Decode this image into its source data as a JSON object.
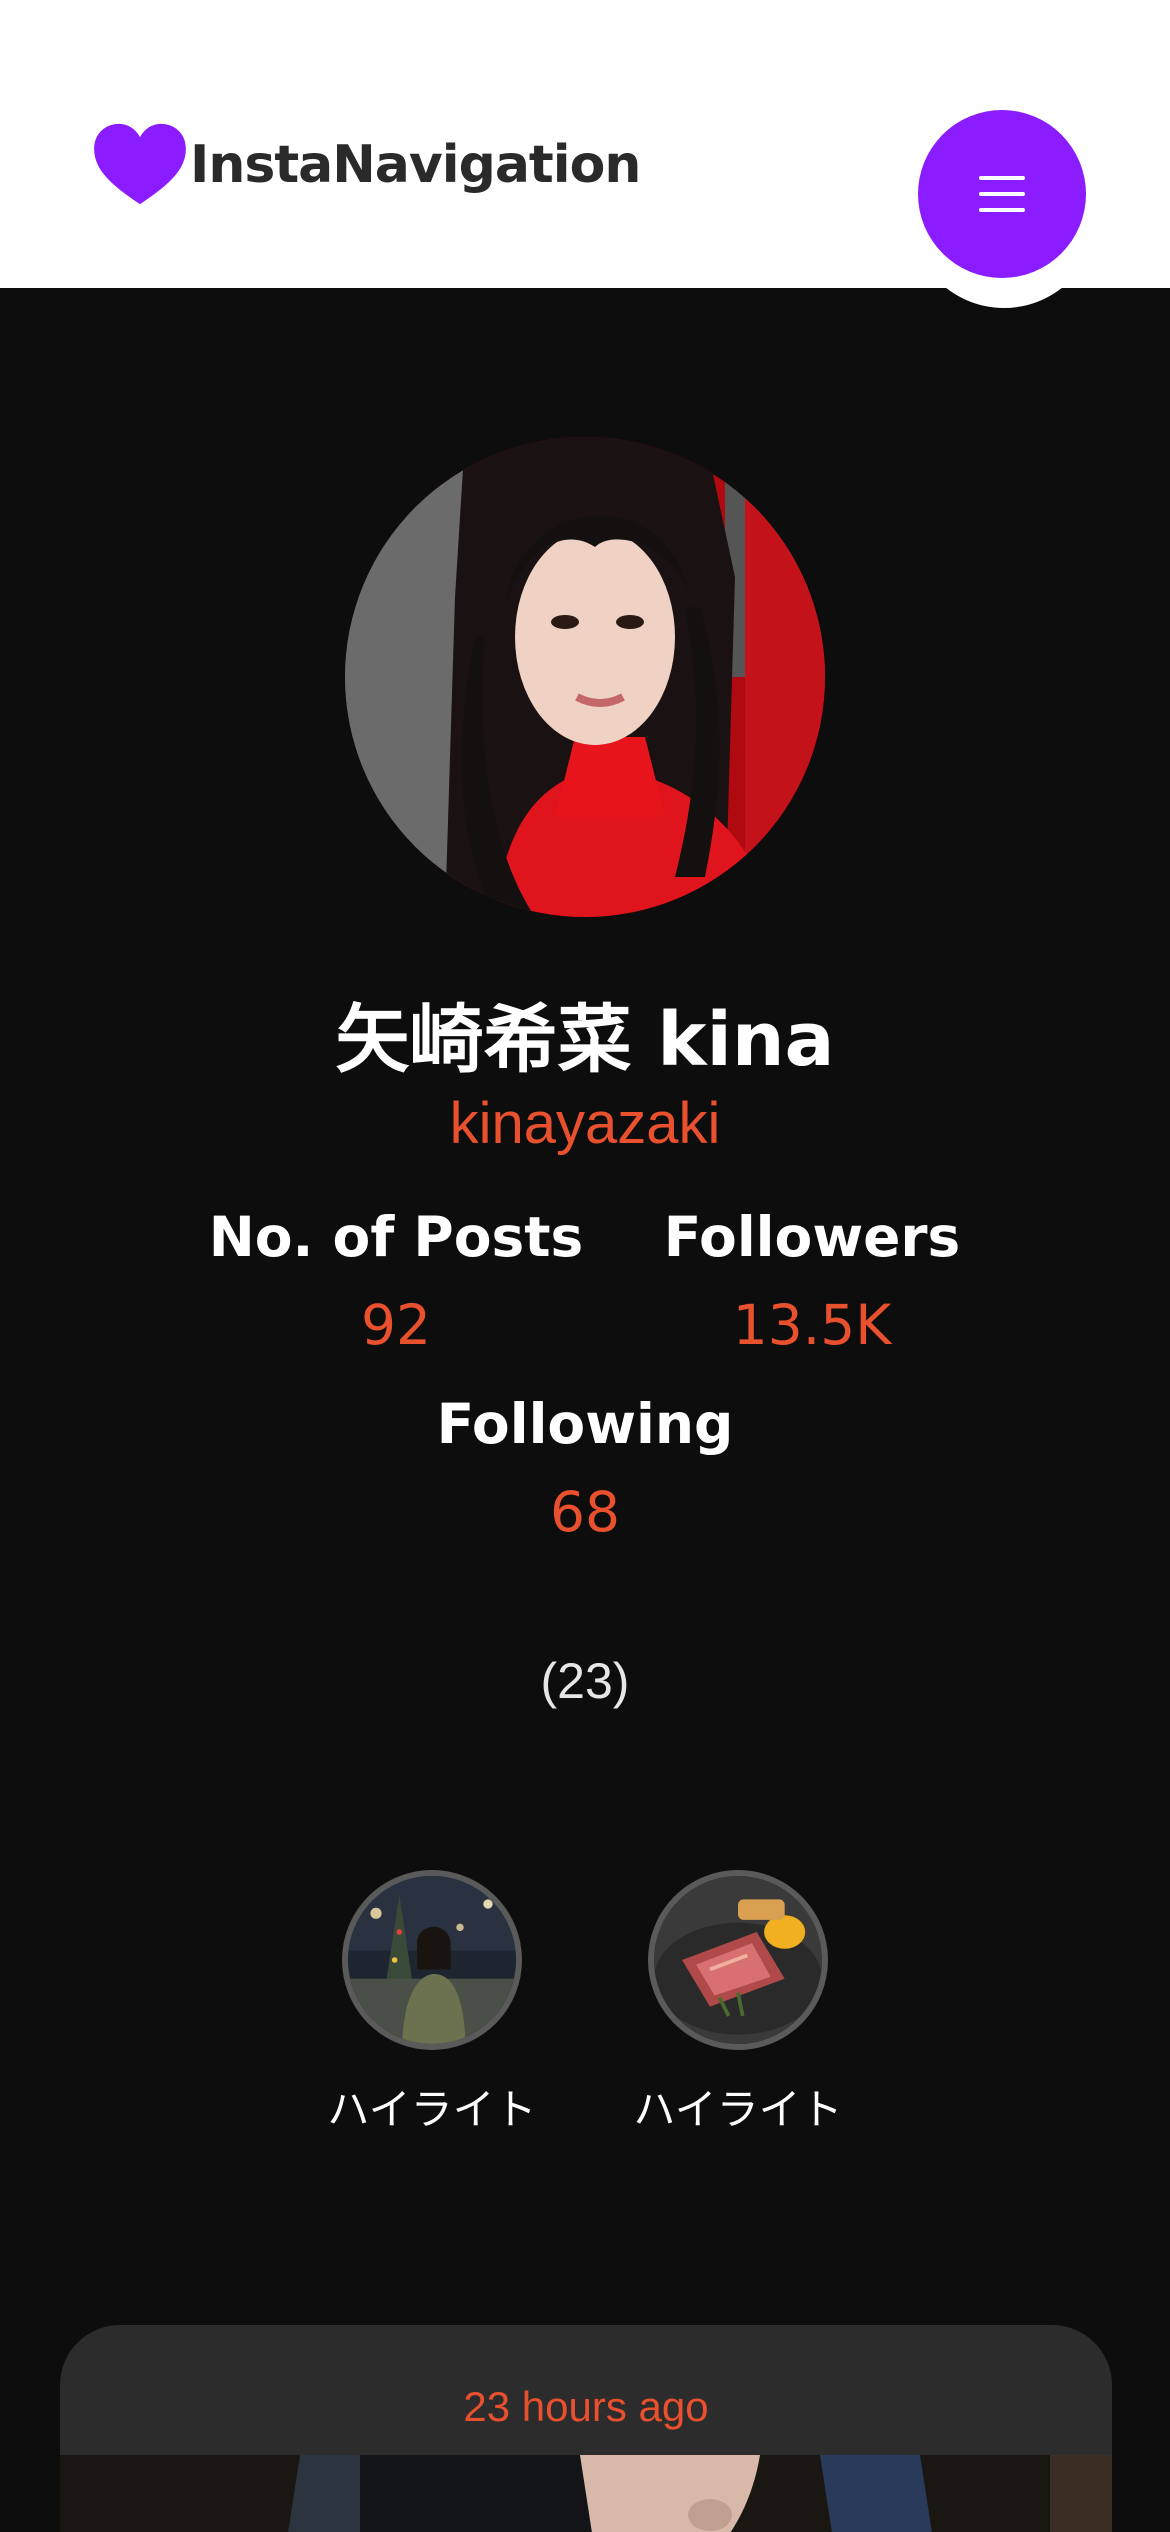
{
  "header": {
    "logo_text": "InstaNavigation",
    "logo_icon": "heart-icon",
    "menu_icon": "hamburger-menu-icon"
  },
  "profile": {
    "full_name": "矢崎希菜 kina",
    "username": "kinayazaki",
    "stats": {
      "posts_label": "No. of Posts",
      "posts_value": "92",
      "followers_label": "Followers",
      "followers_value": "13.5K",
      "following_label": "Following",
      "following_value": "68"
    },
    "count_text": "(23)"
  },
  "highlights": [
    {
      "label": "ハイライト"
    },
    {
      "label": "ハイライト"
    }
  ],
  "posts": [
    {
      "time": "23 hours ago"
    }
  ],
  "colors": {
    "accent": "#e8502e",
    "brand": "#8a1cff",
    "background": "#0d0d0e",
    "card": "#2c2c2c"
  }
}
